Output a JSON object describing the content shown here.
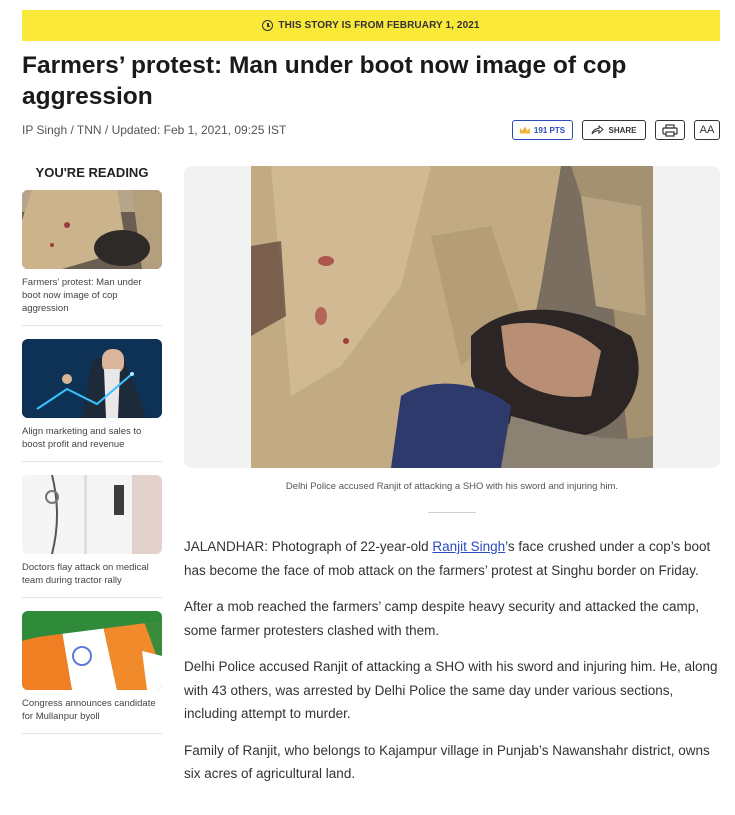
{
  "banner": {
    "text": "THIS STORY IS FROM FEBRUARY 1, 2021"
  },
  "article": {
    "headline": "Farmers’ protest: Man under boot now image of cop aggression",
    "byline": "IP Singh / TNN / Updated: Feb 1, 2021, 09:25 IST",
    "caption": "Delhi Police accused Ranjit of attacking a SHO with his sword and injuring him.",
    "paragraphs": {
      "p1_before": "JALANDHAR: Photograph of 22-year-old ",
      "p1_link": "Ranjit Singh",
      "p1_after": "’s face crushed under a cop’s boot has become the face of mob attack on the farmers’ protest at Singhu border on Friday.",
      "p2": "After a mob reached the farmers’ camp despite heavy security and attacked the camp, some farmer protesters clashed with them.",
      "p3": "Delhi Police accused Ranjit of attacking a SHO with his sword and injuring him. He, along with 43 others, was arrested by Delhi Police the same day under various sections, including attempt to murder.",
      "p4": "Family of Ranjit, who belongs to Kajampur village in Punjab’s Nawanshahr district, owns six acres of agricultural land."
    }
  },
  "toolbar": {
    "points_label": "191 PTS",
    "share_label": "SHARE",
    "font_size_label": "AA",
    "icons": [
      "crown-icon",
      "share-icon",
      "print-icon"
    ]
  },
  "sidebar": {
    "title": "YOU'RE READING",
    "items": [
      {
        "text": "Farmers' protest: Man under boot now image of cop aggression"
      },
      {
        "text": "Align marketing and sales to boost profit and revenue"
      },
      {
        "text": "Doctors flay attack on medical team during tractor rally"
      },
      {
        "text": "Congress announces candidate for Mullanpur byoll"
      }
    ]
  },
  "colors": {
    "banner": "#fbe93a",
    "link": "#2a4ac2",
    "points": "#2b4bb8"
  }
}
